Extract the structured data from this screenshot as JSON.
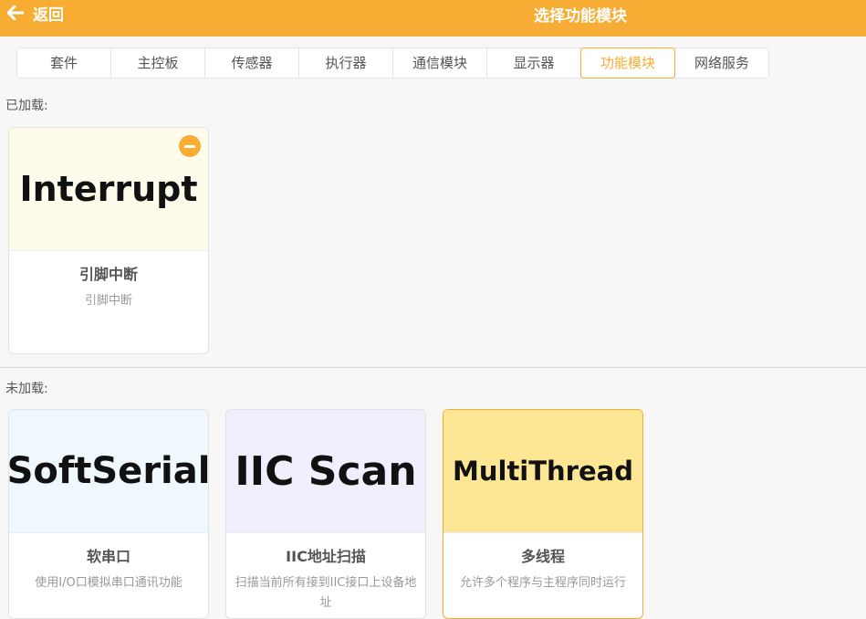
{
  "header": {
    "back_label": "返回",
    "title": "选择功能模块"
  },
  "tabs": [
    {
      "label": "套件",
      "active": false
    },
    {
      "label": "主控板",
      "active": false
    },
    {
      "label": "传感器",
      "active": false
    },
    {
      "label": "执行器",
      "active": false
    },
    {
      "label": "通信模块",
      "active": false
    },
    {
      "label": "显示器",
      "active": false
    },
    {
      "label": "功能模块",
      "active": true
    },
    {
      "label": "网络服务",
      "active": false
    }
  ],
  "loaded": {
    "label": "已加载:",
    "cards": [
      {
        "image_text": "Interrupt",
        "image_bg": "#fefbea",
        "title": "引脚中断",
        "desc": "引脚中断"
      }
    ]
  },
  "unloaded": {
    "label": "未加载:",
    "cards": [
      {
        "image_text": "SoftSerial",
        "image_bg": "#eef8fd",
        "title": "软串口",
        "desc": "使用I/O口模拟串口通讯功能"
      },
      {
        "image_text": "IIC Scan",
        "image_bg": "#f0effd",
        "title": "IIC地址扫描",
        "desc": "扫描当前所有接到IIC接口上设备地址"
      },
      {
        "image_text": "MultiThread",
        "image_bg": "#fde795",
        "title": "多线程",
        "desc": "允许多个程序与主程序同时运行"
      }
    ]
  },
  "colors": {
    "accent": "#f7ad33",
    "background": "#f7f7f7"
  }
}
